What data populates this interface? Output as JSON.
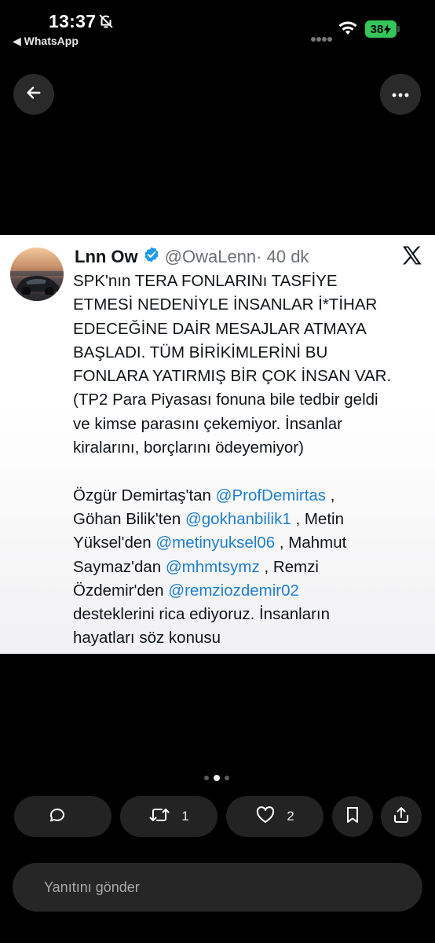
{
  "status_bar": {
    "time": "13:37",
    "back_app": "◀ WhatsApp",
    "battery": "38"
  },
  "icons": {
    "bell_off": "bell-slash-icon",
    "signal": "cellular-signal-icon",
    "wifi": "wifi-icon",
    "back": "arrow-left-icon",
    "more": "more-horizontal-icon",
    "x_logo": "x-logo-icon",
    "verified": "verified-badge-icon",
    "reply": "speech-bubble-icon",
    "repost": "repost-icon",
    "like": "heart-icon",
    "bookmark": "bookmark-icon",
    "share": "share-icon"
  },
  "colors": {
    "accent_link": "#1d7fd6",
    "battery": "#33c759",
    "verified": "#1d9bf0"
  },
  "tweet": {
    "author_name": "Lnn Ow",
    "author_handle": "@OwaLenn",
    "time": "· 40 dk",
    "lines": [
      [
        {
          "t": "SPK'nın TERA FONLARINı TASFİYE"
        }
      ],
      [
        {
          "t": "ETMESİ NEDENİYLE İNSANLAR İ*TİHAR"
        }
      ],
      [
        {
          "t": "EDECEĞİNE DAİR MESAJLAR ATMAYA"
        }
      ],
      [
        {
          "t": "BAŞLADI. TÜM BİRİKİMLERİNİ BU"
        }
      ],
      [
        {
          "t": "FONLARA YATIRMIŞ BİR ÇOK İNSAN VAR."
        }
      ],
      [
        {
          "t": "(TP2 Para Piyasası fonuna bile tedbir geldi"
        }
      ],
      [
        {
          "t": "ve kimse parasını çekemiyor. İnsanlar"
        }
      ],
      [
        {
          "t": "kiralarını, borçlarını ödeyemiyor)"
        }
      ],
      [],
      [
        {
          "t": "Özgür Demirtaş'tan "
        },
        {
          "t": "@ProfDemirtas",
          "m": true
        },
        {
          "t": " ,"
        }
      ],
      [
        {
          "t": "Göhan Bilik'ten "
        },
        {
          "t": "@gokhanbilik1",
          "m": true
        },
        {
          "t": " ,  Metin"
        }
      ],
      [
        {
          "t": "Yüksel'den "
        },
        {
          "t": "@metinyuksel06",
          "m": true
        },
        {
          "t": " , Mahmut"
        }
      ],
      [
        {
          "t": "Saymaz'dan "
        },
        {
          "t": "@mhmtsymz",
          "m": true
        },
        {
          "t": " , Remzi"
        }
      ],
      [
        {
          "t": "Özdemir'den "
        },
        {
          "t": "@remziozdemir02",
          "m": true
        }
      ],
      [
        {
          "t": "desteklerini rica ediyoruz. İnsanların"
        }
      ],
      [
        {
          "t": "hayatları söz konusu"
        }
      ]
    ]
  },
  "pager": {
    "count": 3,
    "active": 1
  },
  "actions": {
    "reply_count": "",
    "repost_count": "1",
    "like_count": "2"
  },
  "reply": {
    "placeholder": "Yanıtını gönder"
  }
}
